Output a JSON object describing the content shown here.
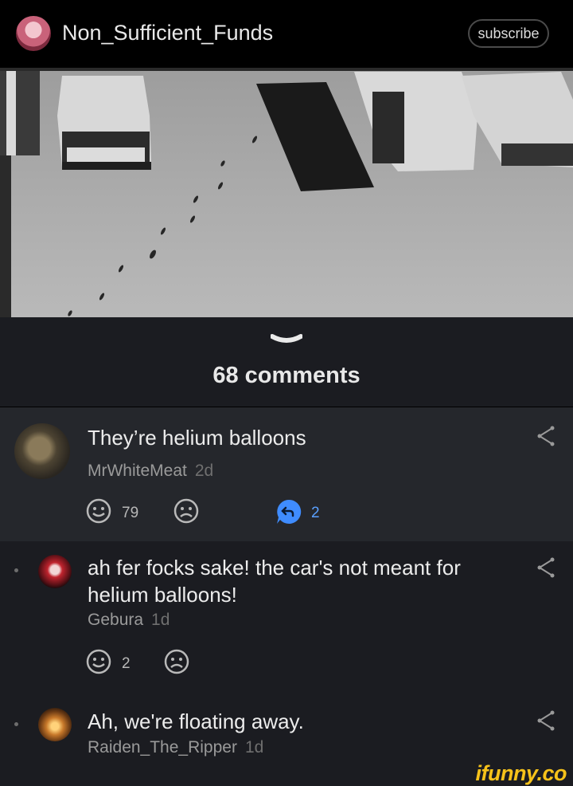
{
  "header": {
    "username": "Non_Sufficient_Funds",
    "subscribe_label": "subscribe"
  },
  "post": {
    "comments_label": "68 comments"
  },
  "comments": [
    {
      "text": "They’re helium balloons",
      "author": "MrWhiteMeat",
      "age": "2d",
      "likes": "79",
      "replies": "2"
    },
    {
      "text_line1": "ah fer focks sake! the car's not meant for",
      "text_line2": "helium balloons!",
      "author": "Gebura",
      "age": "1d",
      "likes": "2"
    },
    {
      "text": "Ah, we're floating away.",
      "author": "Raiden_The_Ripper",
      "age": "1d"
    }
  ],
  "watermark": "ifunny.co",
  "colors": {
    "background": "#1b1c21",
    "highlighted_comment": "#25272c",
    "reply_accent": "#3f8cff",
    "watermark": "#f6c21a"
  },
  "icons": [
    "smile-icon",
    "frown-icon",
    "reply-icon",
    "share-icon",
    "chevron-down-icon"
  ]
}
